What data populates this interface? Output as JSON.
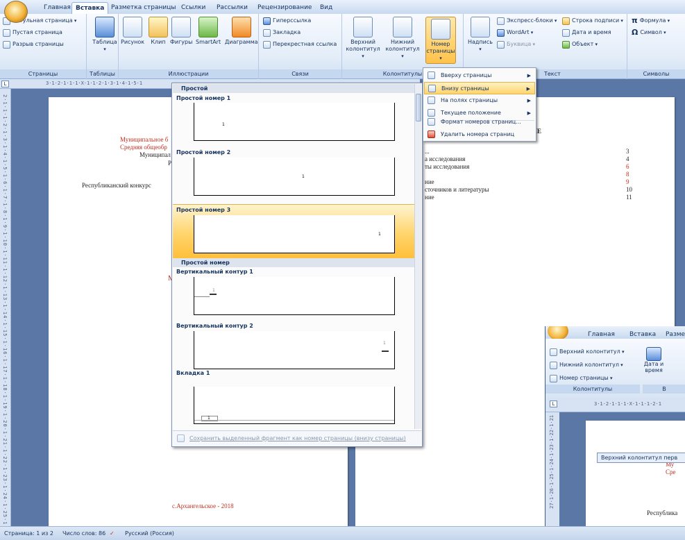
{
  "ribbon": {
    "tabs": [
      "Главная",
      "Вставка",
      "Разметка страницы",
      "Ссылки",
      "Рассылки",
      "Рецензирование",
      "Вид"
    ],
    "pages_group": {
      "items": [
        "Титульная страница",
        "Пустая страница",
        "Разрыв страницы"
      ],
      "label": "Страницы"
    },
    "tables_group": {
      "button": "Таблица",
      "label": "Таблицы"
    },
    "illustrations_group": {
      "buttons": [
        "Рисунок",
        "Клип",
        "Фигуры",
        "SmartArt",
        "Диаграмма"
      ],
      "label": "Иллюстрации"
    },
    "links_group": {
      "items": [
        "Гиперссылка",
        "Закладка",
        "Перекрестная ссылка"
      ],
      "label": "Связи"
    },
    "hf_group": {
      "header": "Верхний колонтитул",
      "footer": "Нижний колонтитул",
      "page_number": "Номер страницы",
      "label": "Колонтитулы"
    },
    "text_group": {
      "textbox": "Надпись",
      "items": [
        "Экспресс-блоки",
        "WordArt",
        "Буквица"
      ],
      "items2": [
        "Строка подписи",
        "Дата и время",
        "Объект"
      ],
      "label": "Текст"
    },
    "symbols_group": {
      "items": [
        "Формула",
        "Символ"
      ],
      "label": "Символы"
    }
  },
  "ruler": {
    "h": "3·1·2·1·1·1·X·1·1·2·1·3·1·4·1·5·1",
    "v": "2·1·1·1·2·1·3·1·4·1·5·1·6·1·7·1·8·1·9·1·10·1·11·1·12·1·13·1·14·1·15·1·16·1·17·1·18·1·19·1·20·1·21·1·22·1·23·1·24·1·25·1·26·1·27"
  },
  "left_page": {
    "lines": [
      "Муниципальное б",
      "Средняя общеобр",
      "Муниципал",
      "Ре",
      "Республиканский конкурс",
      "М"
    ],
    "footer": "с.Архангельское - 2018"
  },
  "right_page": {
    "heading": "ИЕ",
    "toc": [
      {
        "text": "...",
        "page": "3"
      },
      {
        "text": "а исследования",
        "page": "4"
      },
      {
        "text": "ты исследования",
        "page": "6"
      },
      {
        "text": "",
        "page": "8"
      },
      {
        "text": "ние",
        "page": "9"
      },
      {
        "text": "сточников и литературы",
        "page": "10"
      },
      {
        "text": "ние",
        "page": "11"
      }
    ]
  },
  "gallery": {
    "section1": "Простой",
    "items": [
      "Простой номер 1",
      "Простой номер 2",
      "Простой номер 3"
    ],
    "section2": "Простой номер",
    "items2": [
      "Вертикальный контур 1",
      "Вертикальный контур 2",
      "Вкладка 1"
    ],
    "save": "Сохранить выделенный фрагмент как номер страницы (внизу страницы)",
    "num": "1",
    "tab_num": "1"
  },
  "submenu": {
    "items": [
      "Вверху страницы",
      "Внизу страницы",
      "На полях страницы",
      "Текущее положение",
      "Формат номеров страниц...",
      "Удалить номера страниц"
    ]
  },
  "status": {
    "page": "Страница: 1 из 2",
    "words": "Число слов: 86",
    "lang": "Русский (Россия)"
  },
  "inset": {
    "tabs": [
      "Главная",
      "Вставка",
      "Разме"
    ],
    "items": [
      "Верхний колонтитул",
      "Нижний колонтитул",
      "Номер страницы"
    ],
    "date_btn": "Дата и время",
    "group": "Колонтитулы",
    "group2": "В",
    "ruler": "3·1·2·1·1·1·X·1·1·1·2·1",
    "vruler": "27·1·26·1·25·1·24·1·23·1·22·1·21",
    "header_tag": "Верхний колонтитул перв",
    "doc_lines": [
      "Му",
      "Сре",
      "Республика"
    ]
  }
}
